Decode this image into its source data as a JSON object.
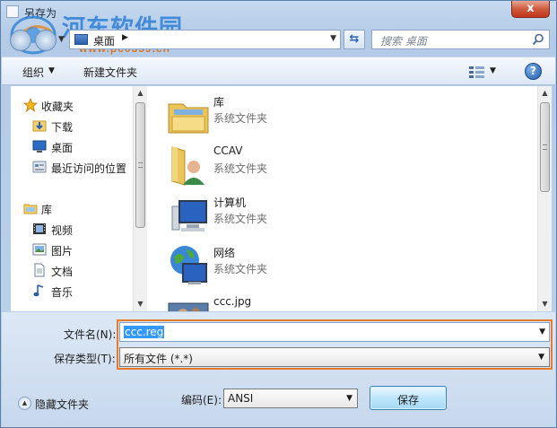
{
  "window": {
    "title": "另存为",
    "close_label": "x"
  },
  "watermark": {
    "text": "河东软件园",
    "url": "www.pc0359.cn"
  },
  "nav": {
    "address": "桌面",
    "search_placeholder": "搜索 桌面"
  },
  "toolbar": {
    "organize_label": "组织",
    "new_folder_label": "新建文件夹",
    "help_label": "?"
  },
  "sidebar": {
    "items": [
      {
        "label": "收藏夹",
        "icon": "star-icon"
      },
      {
        "label": "下载",
        "icon": "download-folder-icon"
      },
      {
        "label": "桌面",
        "icon": "desktop-icon"
      },
      {
        "label": "最近访问的位置",
        "icon": "recent-places-icon"
      },
      {
        "label": "库",
        "icon": "library-icon"
      },
      {
        "label": "视频",
        "icon": "video-icon"
      },
      {
        "label": "图片",
        "icon": "pictures-icon"
      },
      {
        "label": "文档",
        "icon": "documents-icon"
      },
      {
        "label": "音乐",
        "icon": "music-icon"
      }
    ]
  },
  "files": [
    {
      "name": "库",
      "type": "系统文件夹",
      "icon": "library-folder-icon"
    },
    {
      "name": "CCAV",
      "type": "系统文件夹",
      "icon": "user-folder-icon"
    },
    {
      "name": "计算机",
      "type": "系统文件夹",
      "icon": "computer-icon"
    },
    {
      "name": "网络",
      "type": "系统文件夹",
      "icon": "network-icon"
    },
    {
      "name": "ccc.jpg",
      "type": "",
      "icon": "image-file-icon"
    }
  ],
  "form": {
    "filename_label": "文件名(N):",
    "filename_value": "ccc.reg",
    "filetype_label": "保存类型(T):",
    "filetype_value": "所有文件  (*.*)",
    "encoding_label": "编码(E):",
    "encoding_value": "ANSI",
    "save_label": "保存",
    "hide_folders_label": "隐藏文件夹"
  },
  "colors": {
    "highlight": "#e77d2c",
    "selection": "#3399ff",
    "close": "#c1351a"
  }
}
